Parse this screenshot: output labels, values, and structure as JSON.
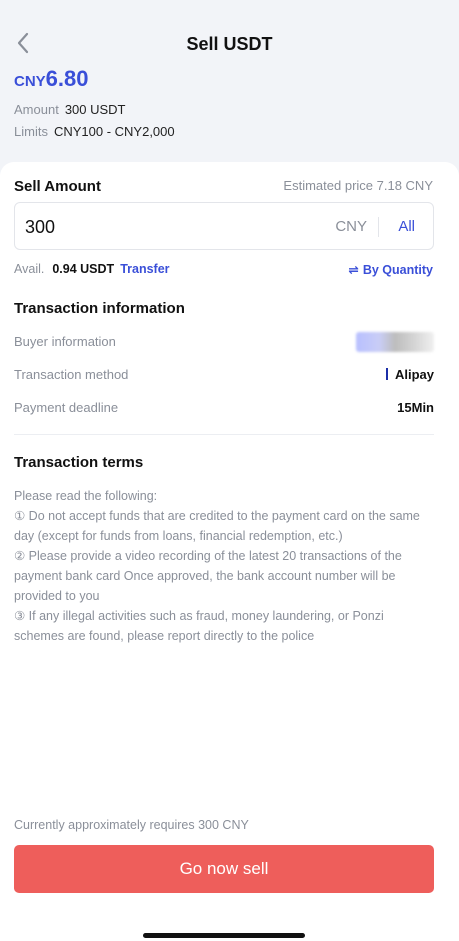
{
  "header": {
    "title": "Sell USDT",
    "price_currency": "CNY",
    "price_value": "6.80",
    "amount_label": "Amount",
    "amount_value": "300 USDT",
    "limits_label": "Limits",
    "limits_value": "CNY100 - CNY2,000"
  },
  "sell": {
    "section_title": "Sell Amount",
    "estimated_price": "Estimated price 7.18 CNY",
    "input_value": "300",
    "currency": "CNY",
    "all_label": "All",
    "avail_label": "Avail.",
    "avail_value": "0.94 USDT",
    "transfer_label": "Transfer",
    "by_quantity_label": "By Quantity"
  },
  "transaction": {
    "section_title": "Transaction information",
    "buyer_label": "Buyer information",
    "method_label": "Transaction method",
    "method_value": "Alipay",
    "deadline_label": "Payment deadline",
    "deadline_value": "15Min"
  },
  "terms": {
    "section_title": "Transaction terms",
    "lines": [
      "Please read the following:",
      "① Do not accept funds that are credited to the payment card on the same day (except for funds from loans, financial redemption, etc.)",
      "② Please provide a video recording of the latest 20 transactions of the payment bank card Once approved, the bank account number will be provided to you",
      "③ If any illegal activities such as fraud, money laundering, or Ponzi schemes are found, please report directly to the police"
    ]
  },
  "footer": {
    "requirement_text": "Currently approximately requires 300 CNY",
    "sell_button": "Go now sell"
  },
  "colors": {
    "accent": "#3a4fd8",
    "sell_button": "#ee5e5b"
  },
  "icons": {
    "back": "chevron-left-icon",
    "quantity": "swap-arrows-icon"
  }
}
